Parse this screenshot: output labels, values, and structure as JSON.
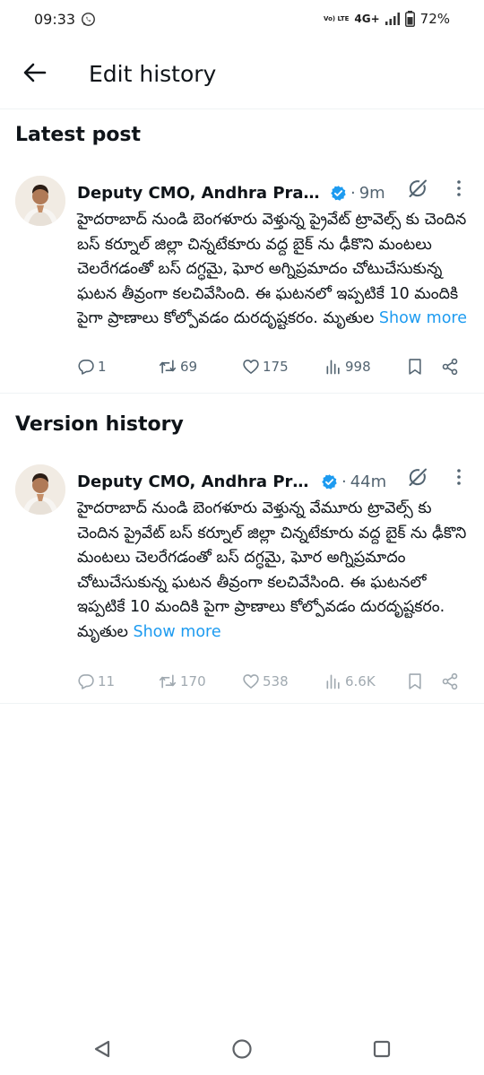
{
  "status_bar": {
    "time": "09:33",
    "network": "4G+",
    "volte": "Vo) LTE",
    "battery": "72%"
  },
  "header": {
    "title": "Edit history"
  },
  "sections": {
    "latest_title": "Latest post",
    "history_title": "Version history"
  },
  "latest_post": {
    "author": "Deputy CMO, Andhra Prad...",
    "timestamp": "9m",
    "text": "హైదరాబాద్ నుండి బెంగళూరు వెళ్తున్న ప్రైవేట్ ట్రావెల్స్ కు చెందిన బస్ కర్నూల్ జిల్లా చిన్నటేకూరు వద్ద బైక్ ను ఢీకొని మంటలు చెలరేగడంతో బస్ దగ్ధమై, ఘోర అగ్నిప్రమాదం చోటుచేసుకున్న ఘటన తీవ్రంగా కలచివేసింది. ఈ ఘటనలో ఇప్పటికే 10 మందికి పైగా ప్రాణాలు కోల్పోవడం దురదృష్టకరం. మృతుల ",
    "show_more": "Show more",
    "replies": "1",
    "reposts": "69",
    "likes": "175",
    "views": "998"
  },
  "history_post": {
    "author": "Deputy CMO, Andhra Prad...",
    "timestamp": "44m",
    "text": "హైదరాబాద్ నుండి బెంగళూరు వెళ్తున్న వేమూరు ట్రావెల్స్ కు చెందిన ప్రైవేట్ బస్ కర్నూల్ జిల్లా చిన్నటేకూరు వద్ద బైక్ ను ఢీకొని మంటలు చెలరేగడంతో బస్ దగ్ధమై, ఘోర అగ్నిప్రమాదం చోటుచేసుకున్న ఘటన తీవ్రంగా కలచివేసింది. ఈ ఘటనలో ఇప్పటికే 10 మందికి పైగా ప్రాణాలు కోల్పోవడం దురదృష్టకరం. మృతుల ",
    "show_more": "Show more",
    "replies": "11",
    "reposts": "170",
    "likes": "538",
    "views": "6.6K"
  },
  "icons": {
    "back": "arrow-left-icon",
    "verified": "verified-badge-icon",
    "grok": "grok-icon",
    "more": "more-vertical-icon",
    "reply": "reply-icon",
    "repost": "repost-icon",
    "like": "heart-icon",
    "views": "views-icon",
    "bookmark": "bookmark-icon",
    "share": "share-icon"
  },
  "colors": {
    "accent": "#1d9bf0",
    "text": "#0f1419",
    "secondary": "#536471"
  }
}
